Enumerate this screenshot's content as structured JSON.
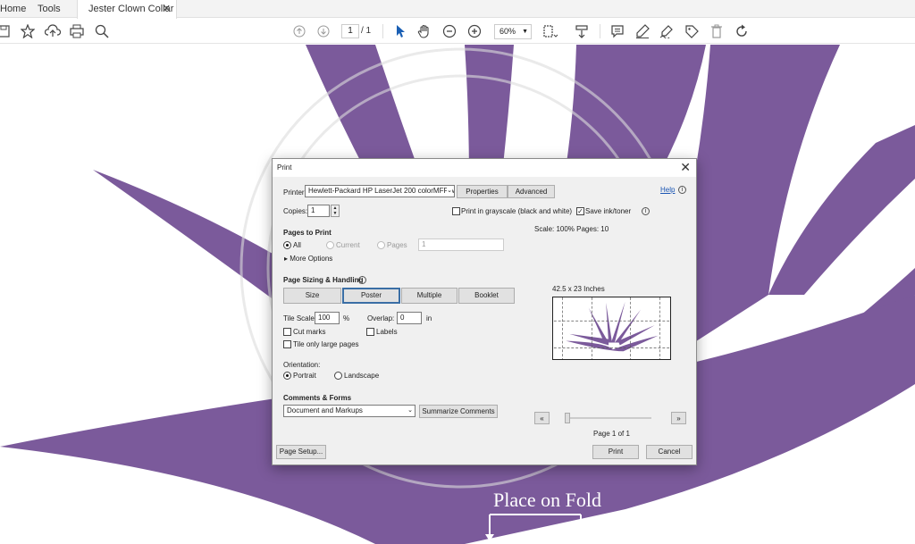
{
  "tabs": {
    "home": "Home",
    "tools": "Tools",
    "document": "Jester Clown Collar ...",
    "close_glyph": "✕"
  },
  "toolbar": {
    "page_current": "1",
    "page_total": "/ 1",
    "zoom": "60%"
  },
  "document": {
    "fold_label": "Place on Fold",
    "art_color": "#7b5a9b"
  },
  "dialog": {
    "title": "Print",
    "help": "Help",
    "printer_label": "Printer:",
    "printer_value": "Hewlett-Packard HP LaserJet 200 colorMFP M",
    "properties": "Properties",
    "advanced": "Advanced",
    "copies_label": "Copies:",
    "copies_value": "1",
    "grayscale": "Print in grayscale (black and white)",
    "save_ink": "Save ink/toner",
    "pages_heading": "Pages to Print",
    "all": "All",
    "current": "Current",
    "pages": "Pages",
    "pages_value": "1",
    "more_options": "More Options",
    "sizing_heading": "Page Sizing & Handling",
    "sizing_options": [
      "Size",
      "Poster",
      "Multiple",
      "Booklet"
    ],
    "active_option": "Poster",
    "tile_scale_label": "Tile Scale:",
    "tile_scale_value": "100",
    "percent": "%",
    "overlap_label": "Overlap:",
    "overlap_value": "0",
    "overlap_unit": "in",
    "cut_marks": "Cut marks",
    "labels": "Labels",
    "tile_large": "Tile only large pages",
    "orientation_heading": "Orientation:",
    "portrait": "Portrait",
    "landscape": "Landscape",
    "comments_heading": "Comments & Forms",
    "comments_value": "Document and Markups",
    "summarize": "Summarize Comments",
    "scale_info": "Scale: 100% Pages: 10",
    "dimensions": "42.5 x 23 Inches",
    "page_of": "Page 1 of 1",
    "prev": "«",
    "next": "»",
    "page_setup": "Page Setup...",
    "print": "Print",
    "cancel": "Cancel"
  }
}
